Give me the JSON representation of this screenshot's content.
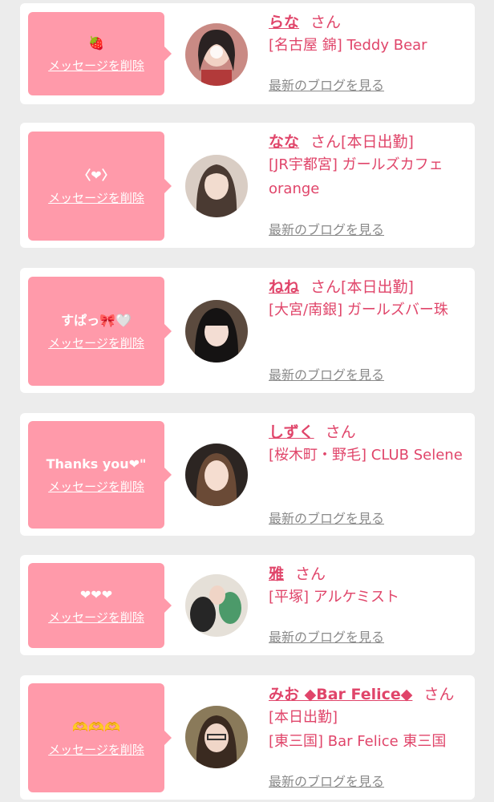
{
  "items": [
    {
      "message": "🍓",
      "delete_label": "メッセージを削除",
      "name": "らな",
      "honorific": "さん",
      "status": "",
      "shop": "[名古屋 錦] Teddy Bear",
      "blog_label": "最新のブログを見る"
    },
    {
      "message": "〈❤〉",
      "delete_label": "メッセージを削除",
      "name": "なな",
      "honorific": "さん",
      "status": "[本日出勤]",
      "shop": "[JR宇都宮] ガールズカフェ orange",
      "blog_label": "最新のブログを見る"
    },
    {
      "message": "すぱっ🎀🤍",
      "delete_label": "メッセージを削除",
      "name": "ねね",
      "honorific": "さん",
      "status": "[本日出勤]",
      "shop": "[大宮/南銀] ガールズバー珠",
      "blog_label": "最新のブログを見る"
    },
    {
      "message": "Thanks you❤\"",
      "delete_label": "メッセージを削除",
      "name": "しずく",
      "honorific": "さん",
      "status": "",
      "shop": "[桜木町・野毛] CLUB Selene",
      "blog_label": "最新のブログを見る"
    },
    {
      "message": "❤❤❤",
      "delete_label": "メッセージを削除",
      "name": "雅",
      "honorific": "さん",
      "status": "",
      "shop": "[平塚] アルケミスト",
      "blog_label": "最新のブログを見る"
    },
    {
      "message": "🫶🫶🫶",
      "delete_label": "メッセージを削除",
      "name": "みお ◆Bar Felice◆",
      "honorific": "さん",
      "status": "[本日出勤]",
      "shop": "[東三国] Bar Felice 東三国",
      "blog_label": "最新のブログを見る"
    }
  ]
}
